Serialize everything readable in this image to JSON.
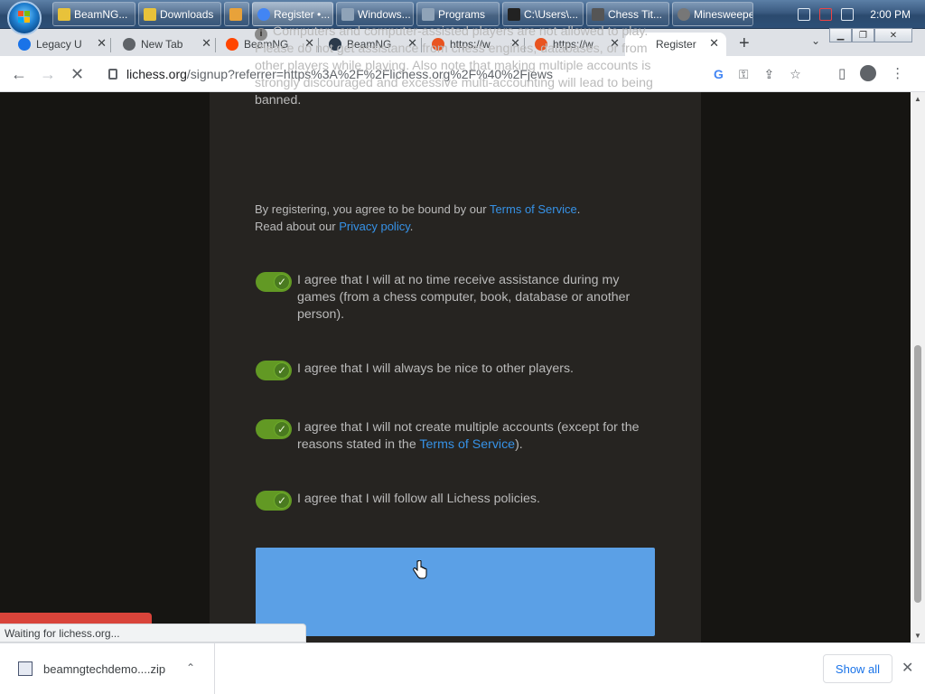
{
  "taskbar": {
    "items": [
      {
        "label": "BeamNG...",
        "color": "#e8c23a"
      },
      {
        "label": "Downloads",
        "color": "#e8c23a"
      },
      {
        "label": "",
        "color": "#e8a23a"
      },
      {
        "label": "Register •...",
        "color": "#4285f4"
      },
      {
        "label": "Windows...",
        "color": "#8fa3b8"
      },
      {
        "label": "Programs",
        "color": "#8fa3b8"
      },
      {
        "label": "C:\\Users\\...",
        "color": "#333333"
      },
      {
        "label": "Chess Tit...",
        "color": "#555555"
      },
      {
        "label": "Minesweeper",
        "color": "#777777"
      }
    ],
    "clock": "2:00 PM"
  },
  "tabs": [
    {
      "label": "Legacy U",
      "icon": "legacy-icon"
    },
    {
      "label": "New Tab",
      "icon": "chrome-icon"
    },
    {
      "label": "BeamNG",
      "icon": "reddit-icon"
    },
    {
      "label": "BeamNG",
      "icon": "beamng-icon"
    },
    {
      "label": "https://w",
      "icon": "ubuntu-icon"
    },
    {
      "label": "https://w",
      "icon": "ubuntu-icon"
    },
    {
      "label": "Register",
      "icon": "lichess-icon"
    }
  ],
  "address": {
    "host": "lichess.org",
    "path": "/signup?referrer=https%3A%2F%2Flichess.org%2F%40%2Fjews"
  },
  "notice": {
    "text": "Computers and computer-assisted players are not allowed to play. Please do not get assistance from chess engines, databases, or from other players while playing. Also note that making multiple accounts is strongly discouraged and excessive multi-accounting will lead to being banned.",
    "tos_prefix": "By registering, you agree to be bound by our ",
    "tos_link": "Terms of Service",
    "tos_suffix": ".",
    "privacy_prefix": "Read about our ",
    "privacy_link": "Privacy policy",
    "privacy_suffix": "."
  },
  "agreements": [
    {
      "text": "I agree that I will at no time receive assistance during my games (from a chess computer, book, database or another person).",
      "checked": true
    },
    {
      "text": "I agree that I will always be nice to other players.",
      "checked": true
    },
    {
      "text_prefix": "I agree that I will not create multiple accounts (except for the reasons stated in the ",
      "link": "Terms of Service",
      "text_suffix": ").",
      "checked": true
    },
    {
      "text": "I agree that I will follow all Lichess policies.",
      "checked": true
    }
  ],
  "colors": {
    "toggle_on": "#629924",
    "link": "#3692e7",
    "submit": "#5ba0e6",
    "panel": "#262421"
  },
  "status": "Waiting for lichess.org...",
  "download": {
    "filename": "beamngtechdemo....zip",
    "show_all": "Show all"
  }
}
